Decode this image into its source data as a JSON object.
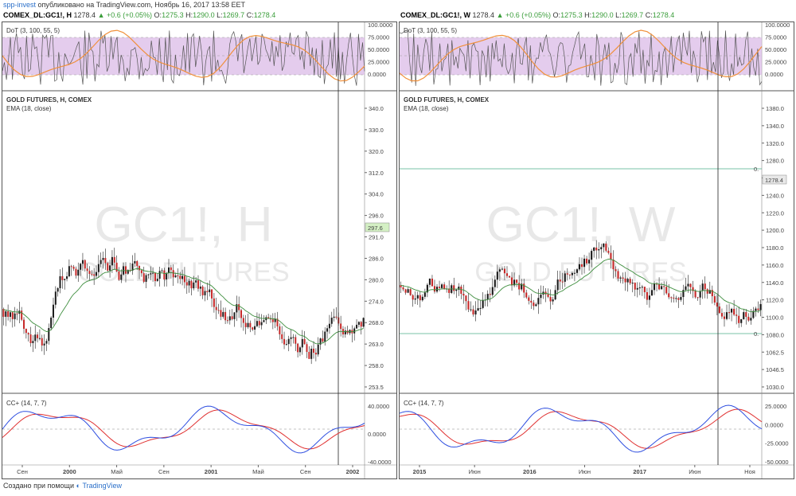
{
  "header": {
    "author": "spp-invest",
    "published": "опубликовано на TradingView.com, Ноябрь 16, 2017 13:58 EET"
  },
  "panes": [
    {
      "symbol": "COMEX_DL:GC1!, H",
      "quote": {
        "close": "1278.4",
        "change": "+0.6 (+0.05%)",
        "o": "1275.3",
        "h": "1290.0",
        "l": "1269.7",
        "c": "1278.4"
      },
      "dot_label": "DoT (3, 100, 55, 5)",
      "dot_axis": [
        "100.0000",
        "75.0000",
        "50.0000",
        "25.0000",
        "0.0000"
      ],
      "main_title": "GOLD FUTURES, H, COMEX",
      "ema_label": "EMA (18, close)",
      "price_axis": [
        "340.0",
        "330.0",
        "320.0",
        "312.0",
        "304.0",
        "296.0",
        "291.0",
        "286.0",
        "280.0",
        "274.0",
        "268.0",
        "263.0",
        "258.0",
        "253.5"
      ],
      "last_price": "297.6",
      "watermark1": "GC1!, H",
      "watermark2": "GOLD FUTURES",
      "cc_label": "CC+ (14, 7, 7)",
      "cc_axis": [
        "40.0000",
        "0.0000",
        "-40.0000"
      ],
      "time_axis": [
        "Сен",
        "2000",
        "Май",
        "Сен",
        "2001",
        "Май",
        "Сен",
        "2002"
      ],
      "fib_labels": []
    },
    {
      "symbol": "COMEX_DL:GC1!, W",
      "quote": {
        "close": "1278.4",
        "change": "+0.6 (+0.05%)",
        "o": "1275.3",
        "h": "1290.0",
        "l": "1269.7",
        "c": "1278.4"
      },
      "dot_label": "DoT (3, 100, 55, 5)",
      "dot_axis": [
        "100.0000",
        "75.0000",
        "50.0000",
        "25.0000",
        "0.0000"
      ],
      "main_title": "GOLD FUTURES, H, COMEX",
      "ema_label": "EMA (18, close)",
      "price_axis": [
        "1380.0",
        "1340.0",
        "1320.0",
        "1280.0",
        "1260.0",
        "1240.0",
        "1220.0",
        "1200.0",
        "1180.0",
        "1160.0",
        "1140.0",
        "1120.0",
        "1100.0",
        "1080.0",
        "1062.5",
        "1046.5",
        "1030.0"
      ],
      "last_price": "1278.4",
      "watermark1": "GC1!, W",
      "watermark2": "GOLD FUTURES",
      "cc_label": "CC+ (14, 7, 7)",
      "cc_axis": [
        "25.0000",
        "0.0000",
        "-25.0000",
        "-50.0000"
      ],
      "time_axis": [
        "2015",
        "Июн",
        "2016",
        "Июн",
        "2017",
        "Июн",
        "Ноя"
      ],
      "fib_labels": [
        "0.",
        "0."
      ]
    }
  ],
  "footer": {
    "created": "Создано при помощи",
    "brand": "TradingView"
  },
  "colors": {
    "candle_up": "#1a1a1a",
    "candle_down": "#c62828",
    "ema": "#3e8e3e",
    "dot_band": "#d9b7e6",
    "dot_orange": "#f0903a",
    "cc_blue": "#2f4fe0",
    "cc_red": "#e03030",
    "fib": "#4caf8a"
  }
}
